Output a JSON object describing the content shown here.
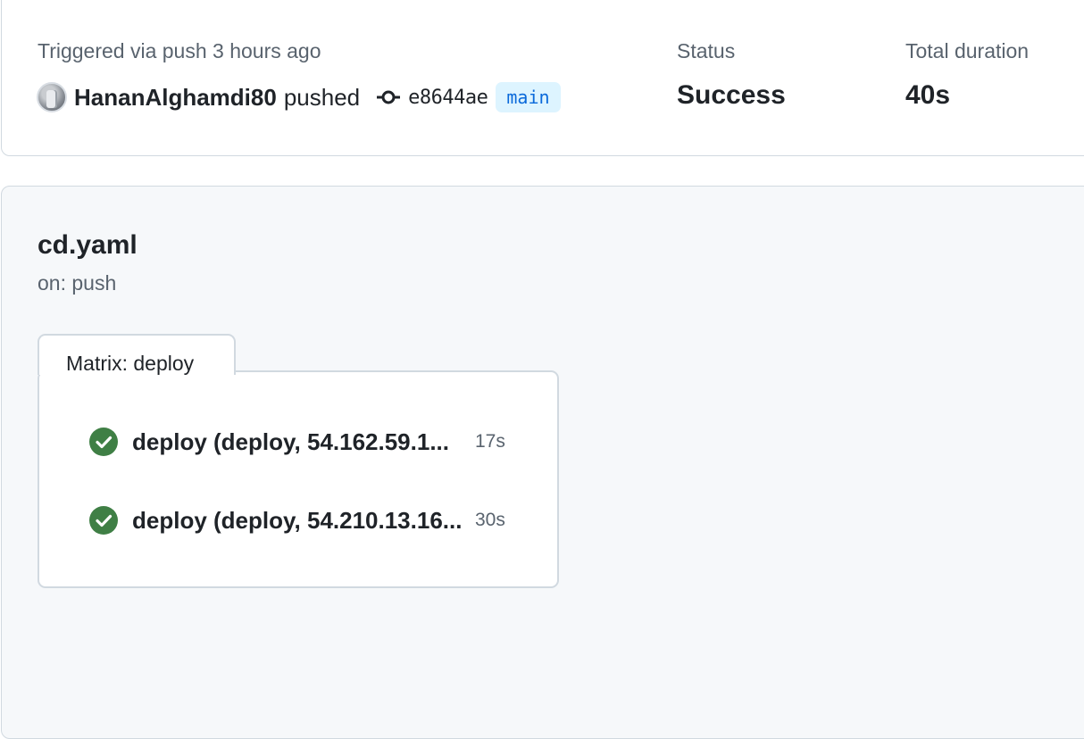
{
  "summary": {
    "trigger_text": "Triggered via push 3 hours ago",
    "actor": "HananAlghamdi80",
    "action": "pushed",
    "commit_sha": "e8644ae",
    "branch": "main",
    "status_label": "Status",
    "status_value": "Success",
    "duration_label": "Total duration",
    "duration_value": "40s"
  },
  "workflow": {
    "name": "cd.yaml",
    "trigger": "on: push",
    "matrix_title": "Matrix: deploy",
    "jobs": [
      {
        "name": "deploy (deploy, 54.162.59.1...",
        "duration": "17s",
        "status": "success"
      },
      {
        "name": "deploy (deploy, 54.210.13.16...",
        "duration": "30s",
        "status": "success"
      }
    ]
  },
  "colors": {
    "success": "#3f7f45",
    "branch_bg": "#ddf4ff",
    "branch_fg": "#0969da",
    "muted": "#59636e"
  },
  "icons": {
    "avatar": "user-avatar",
    "commit": "git-commit-icon",
    "job_status": "check-circle-icon"
  }
}
